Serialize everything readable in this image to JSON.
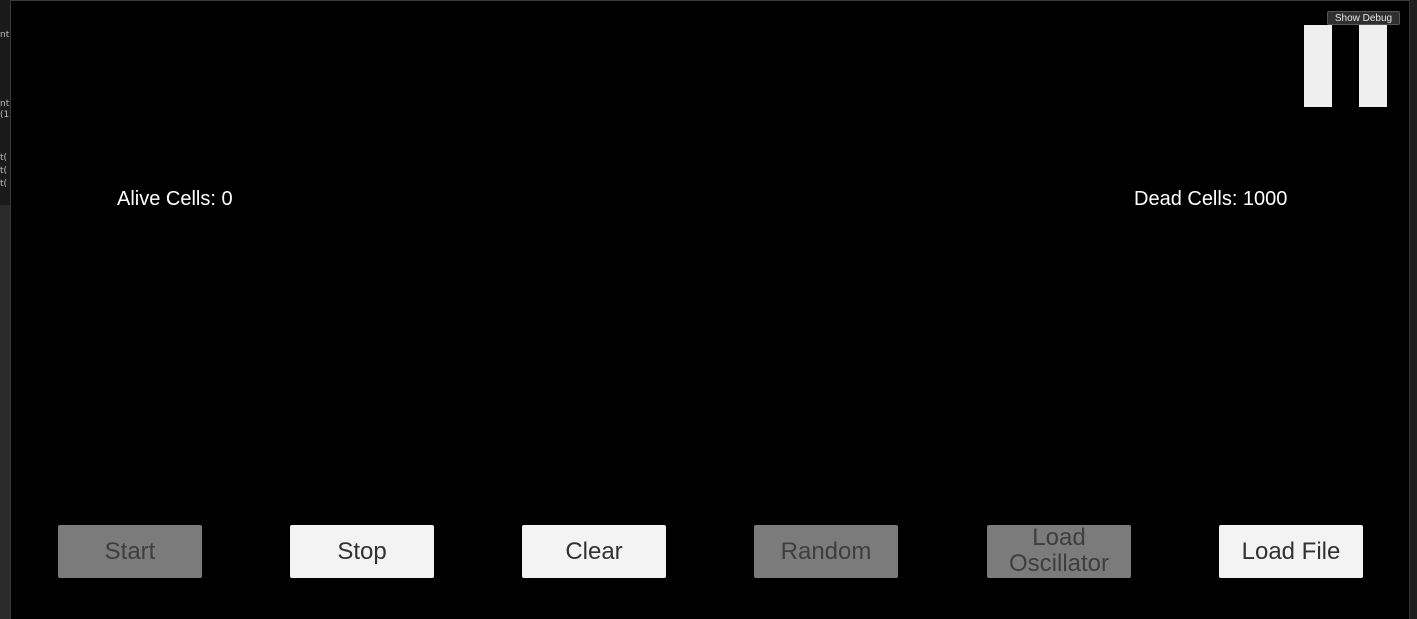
{
  "game_view": {
    "show_debug_label": "Show Debug",
    "alive_cells_label": "Alive Cells: 0",
    "dead_cells_label": "Dead Cells: 1000"
  },
  "editor_snippets": [
    "nt",
    "nt",
    "(1",
    "t(",
    "t(",
    "t("
  ],
  "buttons": [
    {
      "label_line1": "Start",
      "label_line2": "",
      "enabled": false
    },
    {
      "label_line1": "Stop",
      "label_line2": "",
      "enabled": true
    },
    {
      "label_line1": "Clear",
      "label_line2": "",
      "enabled": true
    },
    {
      "label_line1": "Random",
      "label_line2": "",
      "enabled": false
    },
    {
      "label_line1": "Load",
      "label_line2": "Oscillator",
      "enabled": false
    },
    {
      "label_line1": "Load File",
      "label_line2": "",
      "enabled": true
    }
  ],
  "colors": {
    "background": "#000000",
    "button_enabled": "#f3f3f3",
    "button_disabled": "#7b7b7b",
    "text": "#ffffff"
  }
}
